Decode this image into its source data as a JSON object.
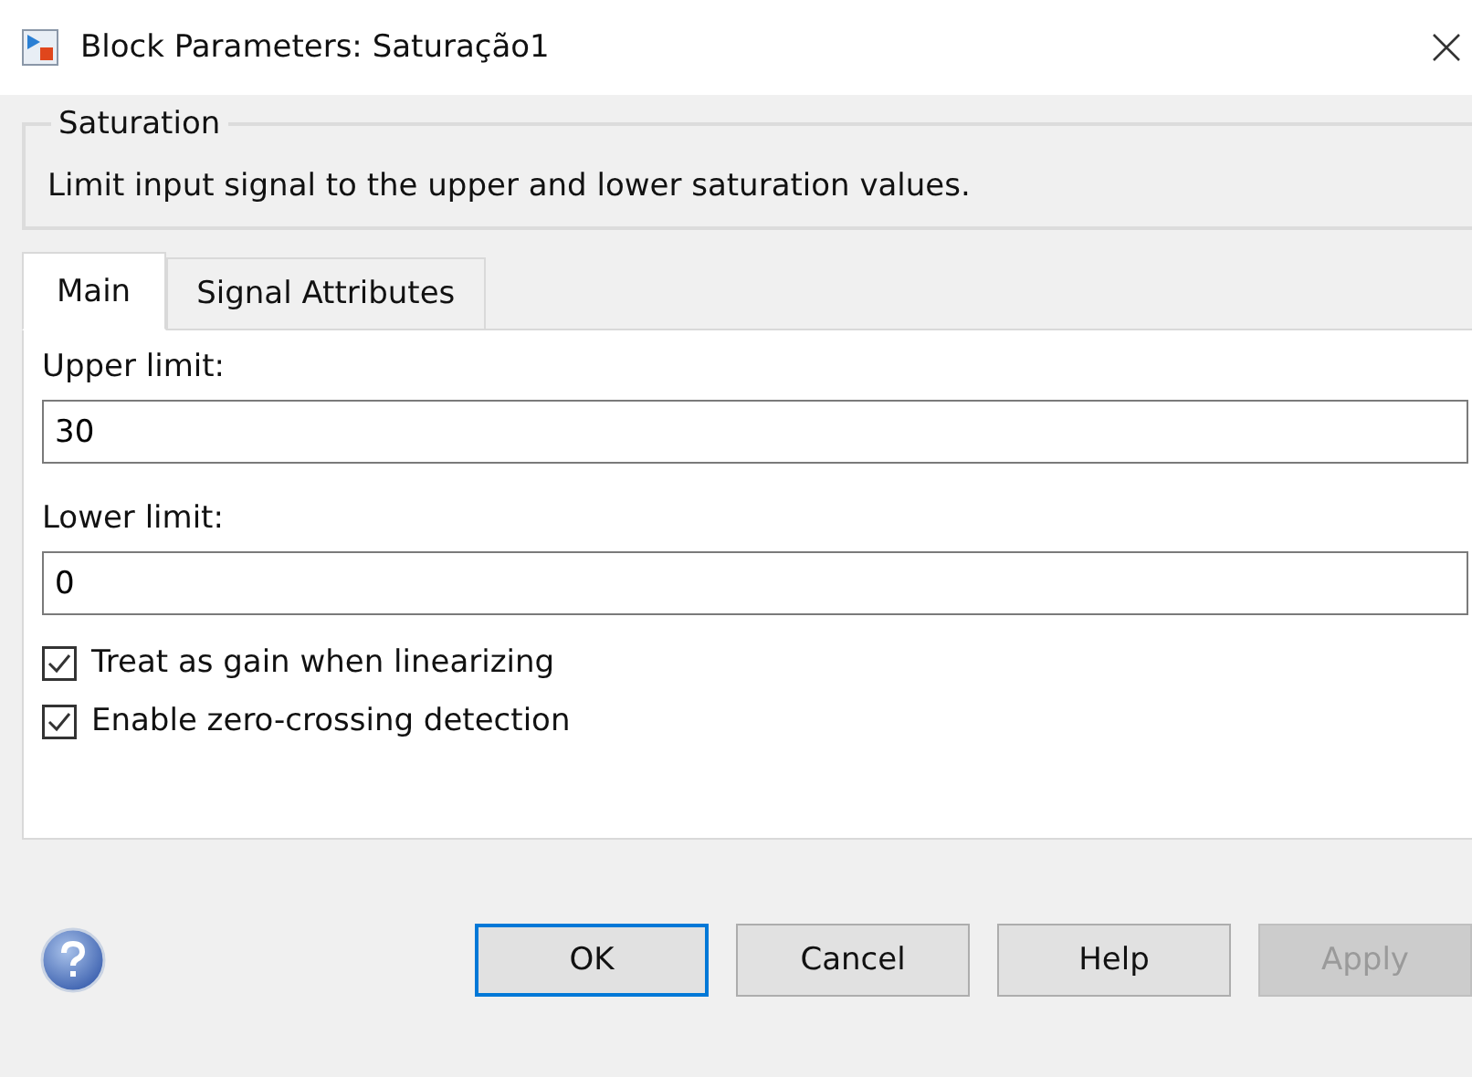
{
  "window": {
    "title": "Block Parameters: Saturação1"
  },
  "group": {
    "title": "Saturation",
    "description": "Limit input signal to the upper and lower saturation values."
  },
  "tabs": [
    {
      "label": "Main",
      "selected": true
    },
    {
      "label": "Signal Attributes",
      "selected": false
    }
  ],
  "fields": [
    {
      "label": "Upper limit:",
      "value": "30"
    },
    {
      "label": "Lower limit:",
      "value": "0"
    }
  ],
  "checkboxes": [
    {
      "label": "Treat as gain when linearizing",
      "checked": true
    },
    {
      "label": "Enable zero-crossing detection",
      "checked": true
    }
  ],
  "buttons": [
    {
      "label": "OK",
      "default": true,
      "disabled": false
    },
    {
      "label": "Cancel",
      "default": false,
      "disabled": false
    },
    {
      "label": "Help",
      "default": false,
      "disabled": false
    },
    {
      "label": "Apply",
      "default": false,
      "disabled": true
    }
  ]
}
